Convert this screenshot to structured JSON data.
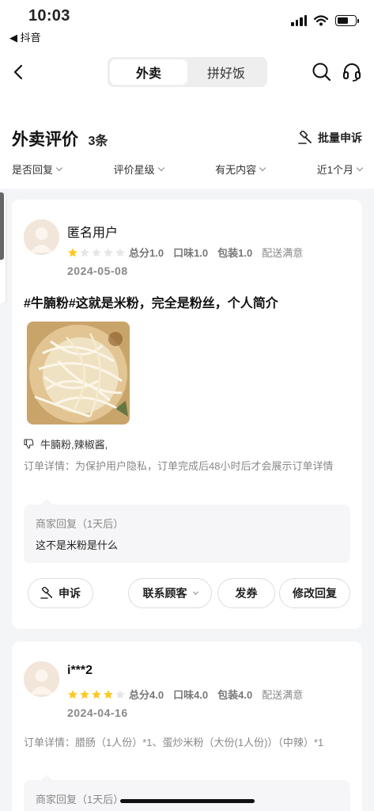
{
  "status_bar": {
    "time": "10:03",
    "back_app": "◀ 抖音"
  },
  "nav": {
    "tabs": [
      {
        "label": "外卖",
        "active": true
      },
      {
        "label": "拼好饭",
        "active": false
      }
    ]
  },
  "header": {
    "title": "外卖评价",
    "count": "3条",
    "bulk_appeal": "批量申诉"
  },
  "filters": [
    "是否回复",
    "评价星级",
    "有无内容",
    "近1个月"
  ],
  "colors": {
    "star_active": "#ffc81e",
    "star_inactive": "#e6e6e6",
    "accent": "#111111"
  },
  "reviews": [
    {
      "user": "匿名用户",
      "rating_stars": 1,
      "scores": {
        "total": "总分1.0",
        "taste": "口味1.0",
        "package": "包装1.0",
        "delivery": "配送满意"
      },
      "date": "2024-05-08",
      "text": "#牛腩粉#这就是米粉，完全是粉丝，个人简介",
      "dislike_items": "牛腩粉,辣椒酱,",
      "order_detail": "订单详情：为保护用户隐私，订单完成后48小时后才会展示订单详情",
      "merchant_reply": {
        "title": "商家回复（1天后）",
        "text": "这不是米粉是什么"
      },
      "buttons": {
        "appeal": "申诉",
        "contact": "联系顾客",
        "coupon": "发券",
        "edit_reply": "修改回复"
      }
    },
    {
      "user": "i***2",
      "rating_stars": 4,
      "scores": {
        "total": "总分4.0",
        "taste": "口味4.0",
        "package": "包装4.0",
        "delivery": "配送满意"
      },
      "date": "2024-04-16",
      "order_detail": "订单详情：腊肠（1人份）*1、蛋炒米粉（大份(1人份)）（中辣）*1",
      "merchant_reply": {
        "title": "商家回复（1天后）"
      }
    }
  ]
}
